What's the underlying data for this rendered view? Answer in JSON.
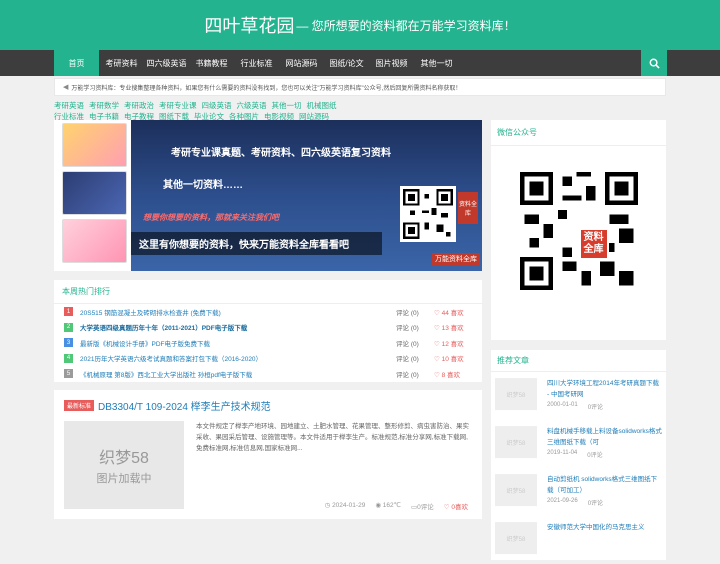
{
  "header": {
    "logo": "四叶草花园",
    "slogan": "— 您所想要的资料都在万能学习资料库！"
  },
  "nav": {
    "items": [
      "首页",
      "考研资料",
      "四六级英语",
      "书籍教程",
      "行业标准",
      "网站源码",
      "图纸/论文",
      "图片视频",
      "其他一切"
    ],
    "active_index": 0
  },
  "notice": {
    "text": "万能学习资料库：专业搜集整理各种资料，如果您有什么需要的资料没有找到，您也可以关注\"万能学习资料库\"公众号,然后回复所需资料名称获取！"
  },
  "tags": [
    "考研英语",
    "考研数学",
    "考研政治",
    "考研专业课",
    "四级英语",
    "六级英语",
    "其他一切",
    "机械图纸",
    "行业标准",
    "电子书籍",
    "电子教程",
    "图纸下载",
    "毕业论文",
    "各种图片",
    "电影视频",
    "网站源码"
  ],
  "banner": {
    "line1": "考研专业课真题、考研资料、四六级英语复习资料",
    "line2": "其他一切资料……",
    "line3": "想要你想要的资料，那就来关注我们吧",
    "caption": "这里有你想要的资料，快来万能资料全库看看吧",
    "badge": "资料全库",
    "brand": "万能资料全库"
  },
  "hot": {
    "title": "本周热门排行",
    "comment_label": "评论",
    "items": [
      {
        "rank": "1",
        "title": "20S515 钢筋混凝土及砖砌排水检查井 (免费下载)",
        "comments": "(0)",
        "likes": "44 喜欢"
      },
      {
        "rank": "2",
        "title": "大学英语四级真题历年十年（2011-2021）PDF电子版下载",
        "comments": "(0)",
        "likes": "13 喜欢"
      },
      {
        "rank": "3",
        "title": "最新版《机械设计手册》PDF电子版免费下载",
        "comments": "(0)",
        "likes": "12 喜欢"
      },
      {
        "rank": "4",
        "title": "2021历年大学英语六级考试真题和答案打包下载（2016-2020）",
        "comments": "(0)",
        "likes": "10 喜欢"
      },
      {
        "rank": "5",
        "title": "《机械原理 第8版》西北工业大学出版社 孙桓pdf电子版下载",
        "comments": "(0)",
        "likes": "8 喜欢"
      }
    ]
  },
  "article": {
    "badge": "最新标准",
    "title": "DB3304/T 109-2024 榉李生产技术规范",
    "img_line1": "织梦58",
    "img_line2": "图片加载中",
    "desc": "本文件规定了榉李产地环境、园地建立、土肥水管理、花果管理、整形修剪、病虫害防治、果实采收、果园采后管理、设施管理等。本文件适用于榉李生产。标准规范,标准分享网,标准下载网,免费标准网,标准信息网,国家标准网...",
    "date": "2024-01-29",
    "views": "162℃",
    "comments": "0评论",
    "likes": "0喜欢"
  },
  "sidebar": {
    "wx_title": "微信公众号",
    "wx_logo": "资料全库",
    "rec_title": "推荐文章",
    "rec_items": [
      {
        "title": "四川大学环境工程2014年考研真题下载 - 中国考研网",
        "date": "2000-01-01",
        "comments": "0评论",
        "img": "织梦58"
      },
      {
        "title": "料盘机械手移载上料设备solidworks格式三维图纸下载（可",
        "date": "2019-11-04",
        "comments": "0评论",
        "img": "织梦58"
      },
      {
        "title": "自动剪纸机 solidworks格式三维图纸下载（可加工）",
        "date": "2021-09-26",
        "comments": "0评论",
        "img": "织梦58"
      },
      {
        "title": "安徽师范大学中国化的马克思主义",
        "date": "",
        "comments": "",
        "img": "织梦58"
      }
    ]
  }
}
